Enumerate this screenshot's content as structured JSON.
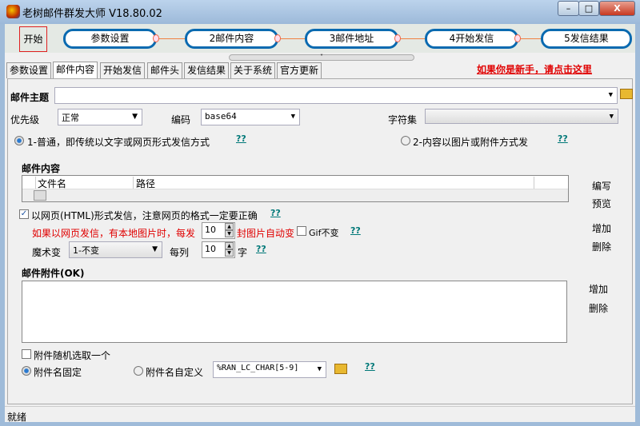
{
  "window": {
    "title": "老树邮件群发大师 V18.80.02",
    "min": "–",
    "max": "□",
    "close": "X"
  },
  "flow": {
    "start": "开始",
    "steps": [
      "参数设置",
      "2邮件内容",
      "3邮件地址",
      "4开始发信",
      "5发信结果"
    ]
  },
  "tabs": [
    "参数设置",
    "邮件内容",
    "开始发信",
    "邮件头",
    "发信结果",
    "关于系统",
    "官方更新"
  ],
  "newbie_link": "如果你是新手，请点击这里",
  "form": {
    "subject_label": "邮件主题",
    "subject_value": "",
    "priority_label": "优先级",
    "priority_value": "正常",
    "encoding_label": "编码",
    "encoding_value": "base64",
    "charset_label": "字符集",
    "charset_value": "",
    "mode1": "1-普通，即传统以文字或网页形式发信方式",
    "mode2": "2-内容以图片或附件方式发",
    "help": "??",
    "content_label": "邮件内容",
    "columns": [
      "文件名",
      "路径"
    ],
    "edit": "编写",
    "preview": "预览",
    "add": "增加",
    "delete": "删除",
    "html_check": "以网页(HTML)形式发信，注意网页的格式一定要正确",
    "img_prefix": "如果以网页发信，有本地图片时，每发",
    "img_count": "10",
    "img_suffix": "封图片自动变",
    "gif_label": "Gif不变",
    "magic_label": "魔术变",
    "magic_value": "1-不变",
    "per_col_label": "每列",
    "per_col_value": "10",
    "char_label": "字",
    "attach_label": "邮件附件(OK)",
    "random_attach": "附件随机选取一个",
    "fixed_name": "附件名固定",
    "custom_name": "附件名自定义",
    "custom_value": "%RAN_LC_CHAR[5-9]"
  },
  "status": "就绪"
}
